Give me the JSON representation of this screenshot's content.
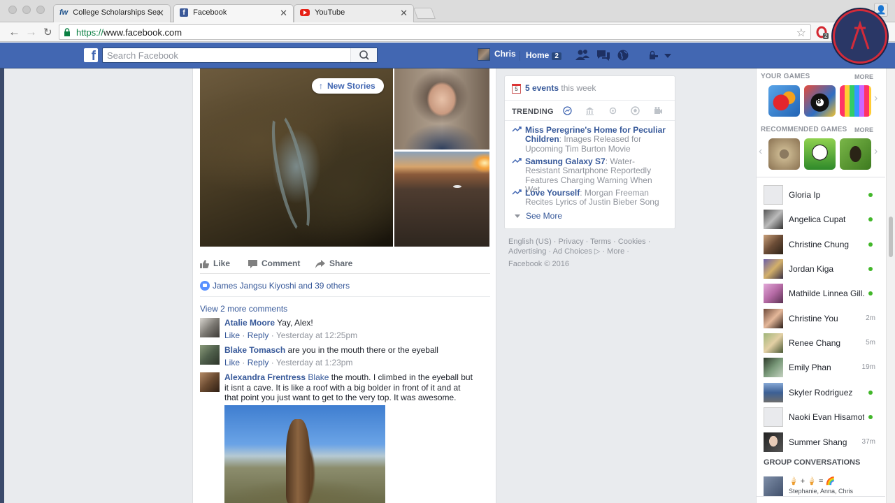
{
  "browser": {
    "tabs": [
      {
        "title": "College Scholarships Search",
        "favicon": "fw-icon",
        "active": false
      },
      {
        "title": "Facebook",
        "favicon": "facebook-icon",
        "active": true
      },
      {
        "title": "YouTube",
        "favicon": "youtube-icon",
        "active": false
      }
    ],
    "url_scheme": "https://",
    "url_host": "www.facebook.com",
    "extension_badge": "2"
  },
  "fb_header": {
    "logo_letter": "f",
    "search_placeholder": "Search Facebook",
    "profile_name": "Chris",
    "home_label": "Home",
    "home_count": "2"
  },
  "feed": {
    "new_stories": "New Stories",
    "actions": {
      "like": "Like",
      "comment": "Comment",
      "share": "Share"
    },
    "likes_summary": "James Jangsu Kiyoshi and 39 others",
    "view_more_comments": "View 2 more comments",
    "comments": [
      {
        "author": "Atalie Moore",
        "text": "Yay, Alex!",
        "like": "Like",
        "reply": "Reply",
        "time": "Yesterday at 12:25pm"
      },
      {
        "author": "Blake Tomasch",
        "text": "are you in the mouth there or the eyeball",
        "like": "Like",
        "reply": "Reply",
        "time": "Yesterday at 1:23pm"
      },
      {
        "author": "Alexandra Frentress",
        "mention": "Blake",
        "text": "the mouth. I climbed in the eyeball but it isnt a cave. It is like a roof with a big bolder in front of it and at that point you just want to get to the very top. It was awesome."
      }
    ]
  },
  "right": {
    "events_count": "5 events",
    "events_suffix": "this week",
    "calendar_day": "5",
    "trending_title": "TRENDING",
    "trending": [
      {
        "title": "Miss Peregrine's Home for Peculiar Children",
        "desc": ": Images Released for Upcoming Tim Burton Movie"
      },
      {
        "title": "Samsung Galaxy S7",
        "desc": ": Water-Resistant Smartphone Reportedly Features Charging Warning When Wet"
      },
      {
        "title": "Love Yourself",
        "desc": ": Morgan Freeman Recites Lyrics of Justin Bieber Song"
      }
    ],
    "see_more": "See More",
    "footer_links": [
      "English (US)",
      "Privacy",
      "Terms",
      "Cookies",
      "Advertising",
      "Ad Choices",
      "More"
    ],
    "copyright": "Facebook © 2016"
  },
  "sidebar": {
    "your_games": "YOUR GAMES",
    "recommended_games": "RECOMMENDED GAMES",
    "more": "MORE",
    "contacts": [
      {
        "name": "Gloria Ip",
        "status": "online",
        "time": ""
      },
      {
        "name": "Angelica Cupat",
        "status": "online",
        "time": ""
      },
      {
        "name": "Christine Chung",
        "status": "online",
        "time": ""
      },
      {
        "name": "Jordan Kiga",
        "status": "online",
        "time": ""
      },
      {
        "name": "Mathilde Linnea Gill...",
        "status": "online",
        "time": ""
      },
      {
        "name": "Christine You",
        "status": "idle",
        "time": "2m"
      },
      {
        "name": "Renee Chang",
        "status": "idle",
        "time": "5m"
      },
      {
        "name": "Emily Phan",
        "status": "idle",
        "time": "19m"
      },
      {
        "name": "Skyler Rodriguez",
        "status": "online",
        "time": ""
      },
      {
        "name": "Naoki Evan Hisamoto",
        "status": "online",
        "time": ""
      },
      {
        "name": "Summer Shang",
        "status": "idle",
        "time": "37m"
      }
    ],
    "group_conversations": "GROUP CONVERSATIONS",
    "group_names": "Stephanie, Anna, Chris"
  },
  "colors": {
    "fb_blue": "#4267b2",
    "link_blue": "#365899",
    "online_green": "#42b72a",
    "like_blue": "#5890ff"
  }
}
